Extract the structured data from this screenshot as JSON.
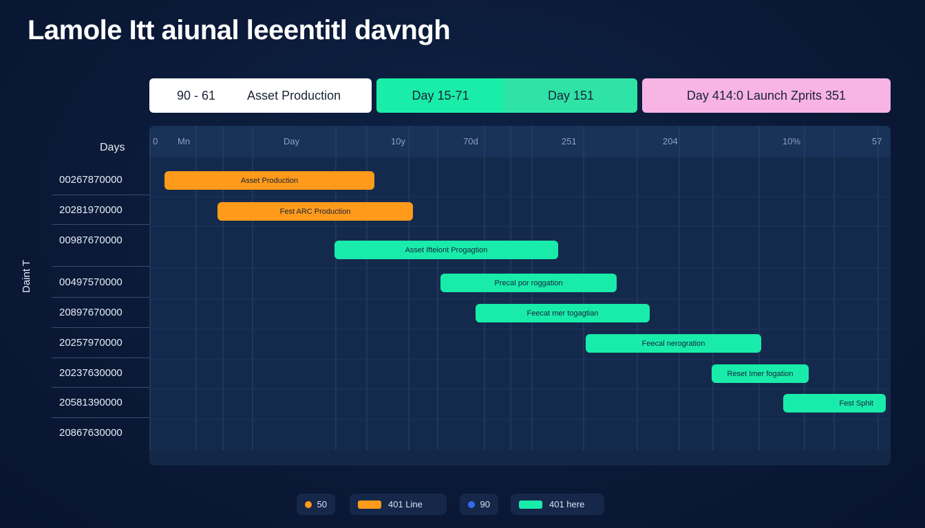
{
  "title": "Lamole Itt aiunal leeentitl davngh",
  "phases": {
    "p1_range": "90 - 61",
    "p1_name": "Asset Production",
    "p2_left": "Day 15-71",
    "p2_right": "Day 151",
    "p3": "Day 414:0 Launch Zprits 351"
  },
  "axis": {
    "days_label": "Days",
    "y_title": "Daint T",
    "ticks": [
      "0",
      "Mn",
      "Day",
      "10y",
      "70d",
      "251",
      "204",
      "10%",
      "57"
    ]
  },
  "rows": [
    "00267870000",
    "20281970000",
    "00987670000",
    "00497570000",
    "20897670000",
    "20257970000",
    "20237630000",
    "20581390000",
    "20867630000"
  ],
  "chart_data": {
    "type": "gantt",
    "title": "Lamole Itt aiunal leeentitl davngh",
    "tasks": [
      {
        "label": "Asset Production",
        "color": "#ff9a1a"
      },
      {
        "label": "Fest ARC Production",
        "color": "#ff9a1a"
      },
      {
        "label": "Asset Ifteiont Progagtion",
        "color": "#19ecaa"
      },
      {
        "label": "Precal por roggation",
        "color": "#19ecaa"
      },
      {
        "label": "Feecat mer togagtian",
        "color": "#19ecaa"
      },
      {
        "label": "Feecal nerogration",
        "color": "#19ecaa"
      },
      {
        "label": "Reset Imer fogation",
        "color": "#19ecaa"
      },
      {
        "label": "Fest Sphit",
        "color": "#19ecaa"
      }
    ]
  },
  "legend": [
    {
      "label": "50",
      "color": "#ff9a1a",
      "kind": "dot"
    },
    {
      "label": "401 Line",
      "color": "#ff9a1a",
      "kind": "swatch"
    },
    {
      "label": "90",
      "color": "#2f6cf0",
      "kind": "dot"
    },
    {
      "label": "401 here",
      "color": "#19ecaa",
      "kind": "swatch"
    }
  ]
}
